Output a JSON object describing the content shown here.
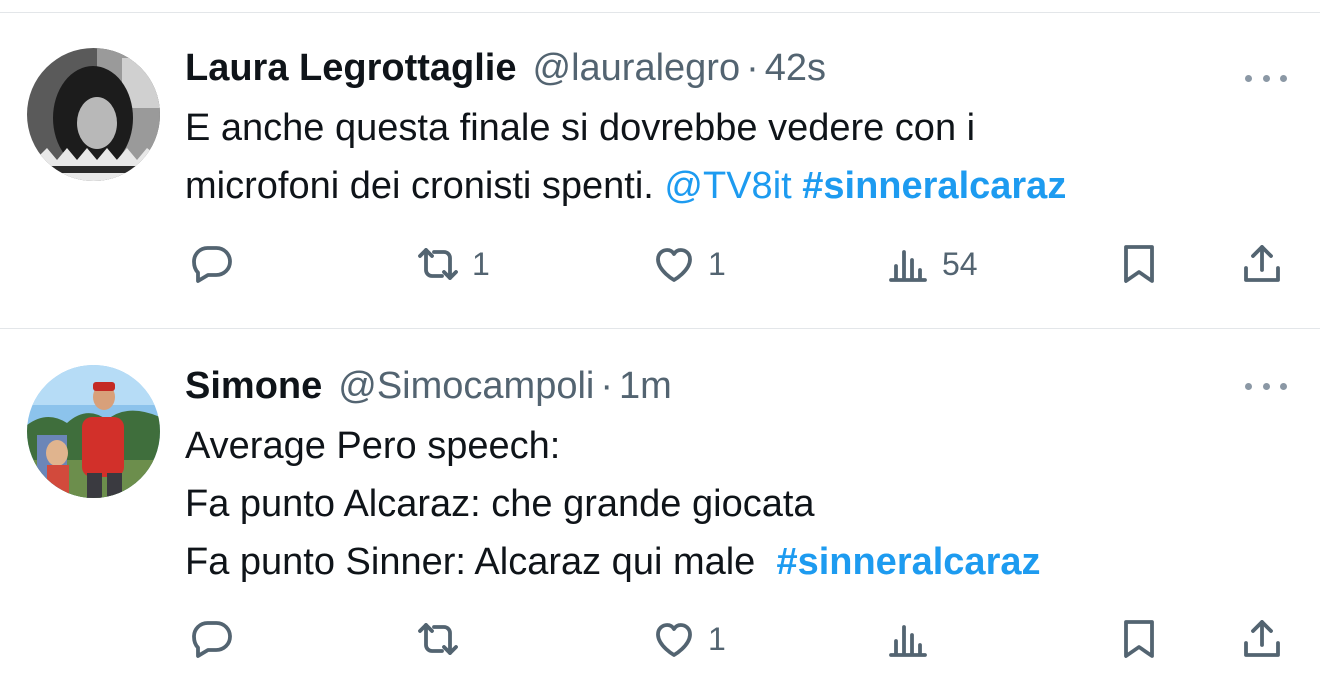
{
  "tweets": [
    {
      "name": "Laura Legrottaglie",
      "handle": "@lauralegro",
      "separator": "·",
      "time": "42s",
      "lines": [
        [
          {
            "t": "text",
            "v": "E anche questa finale si dovrebbe vedere con i"
          }
        ],
        [
          {
            "t": "text",
            "v": "microfoni dei cronisti spenti. "
          },
          {
            "t": "mention",
            "v": "@TV8it"
          },
          {
            "t": "text",
            "v": " "
          },
          {
            "t": "hashtag",
            "v": "#sinneralcaraz"
          }
        ]
      ],
      "actions": {
        "replies": "",
        "retweets": "1",
        "likes": "1",
        "views": "54"
      }
    },
    {
      "name": "Simone",
      "handle": "@Simocampoli",
      "separator": "·",
      "time": "1m",
      "lines": [
        [
          {
            "t": "text",
            "v": "Average Pero speech:"
          }
        ],
        [
          {
            "t": "text",
            "v": "Fa punto Alcaraz: che grande giocata"
          }
        ],
        [
          {
            "t": "text",
            "v": "Fa punto Sinner: Alcaraz qui male  "
          },
          {
            "t": "hashtag",
            "v": "#sinneralcaraz"
          }
        ]
      ],
      "actions": {
        "replies": "",
        "retweets": "",
        "likes": "1",
        "views": ""
      }
    }
  ],
  "icons": {
    "reply": "reply-icon",
    "retweet": "retweet-icon",
    "like": "heart-icon",
    "views": "views-chart-icon",
    "bookmark": "bookmark-icon",
    "share": "share-icon",
    "more": "more-horizontal-icon"
  },
  "colors": {
    "link": "#1d9bf0",
    "secondary_text": "#536471",
    "primary_text": "#0f1419"
  }
}
